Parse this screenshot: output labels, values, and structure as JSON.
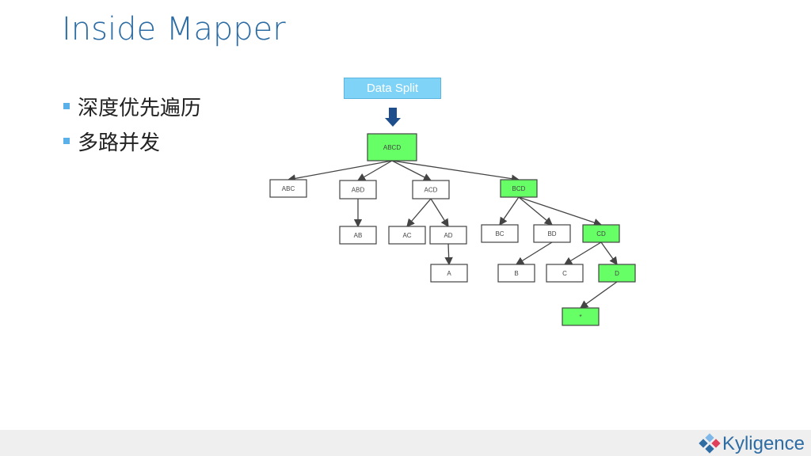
{
  "title": "Inside Mapper",
  "bullets": [
    "深度优先遍历",
    "多路并发"
  ],
  "diagram": {
    "source_label": "Data Split",
    "colors": {
      "highlight": "#66ff66",
      "source": "#7fd3f7",
      "arrow": "#1f4e8c"
    },
    "nodes": [
      {
        "id": "ABCD",
        "label": "ABCD",
        "highlight": true
      },
      {
        "id": "ABC",
        "label": "ABC",
        "highlight": false
      },
      {
        "id": "ABD",
        "label": "ABD",
        "highlight": false
      },
      {
        "id": "ACD",
        "label": "ACD",
        "highlight": false
      },
      {
        "id": "BCD",
        "label": "BCD",
        "highlight": true
      },
      {
        "id": "AB",
        "label": "AB",
        "highlight": false
      },
      {
        "id": "AC",
        "label": "AC",
        "highlight": false
      },
      {
        "id": "AD",
        "label": "AD",
        "highlight": false
      },
      {
        "id": "BC",
        "label": "BC",
        "highlight": false
      },
      {
        "id": "BD",
        "label": "BD",
        "highlight": false
      },
      {
        "id": "CD",
        "label": "CD",
        "highlight": true
      },
      {
        "id": "A",
        "label": "A",
        "highlight": false
      },
      {
        "id": "B",
        "label": "B",
        "highlight": false
      },
      {
        "id": "C",
        "label": "C",
        "highlight": false
      },
      {
        "id": "D",
        "label": "D",
        "highlight": true
      },
      {
        "id": "ALL",
        "label": "*",
        "highlight": true
      }
    ],
    "edges": [
      [
        "ABCD",
        "ABC"
      ],
      [
        "ABCD",
        "ABD"
      ],
      [
        "ABCD",
        "ACD"
      ],
      [
        "ABCD",
        "BCD"
      ],
      [
        "ABD",
        "AB"
      ],
      [
        "ACD",
        "AC"
      ],
      [
        "ACD",
        "AD"
      ],
      [
        "AD",
        "A"
      ],
      [
        "BCD",
        "BC"
      ],
      [
        "BCD",
        "BD"
      ],
      [
        "BCD",
        "CD"
      ],
      [
        "BD",
        "B"
      ],
      [
        "CD",
        "C"
      ],
      [
        "CD",
        "D"
      ],
      [
        "D",
        "ALL"
      ]
    ]
  },
  "footer": {
    "logo_text": "Kyligence"
  }
}
